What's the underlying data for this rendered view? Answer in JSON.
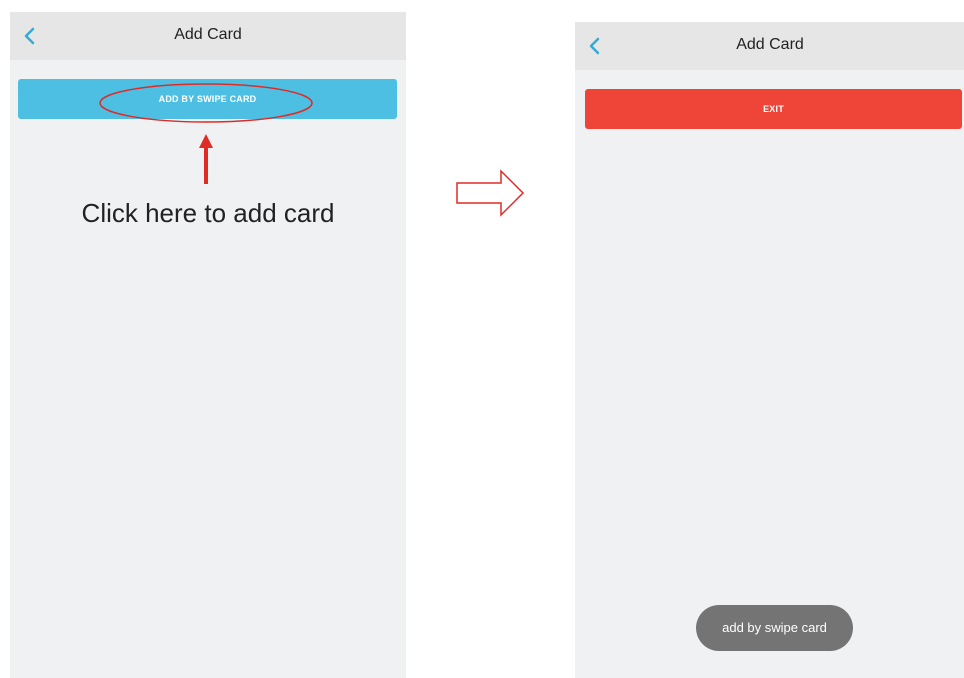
{
  "left_screen": {
    "header": {
      "back_icon": "chevron-left-icon",
      "title": "Add Card"
    },
    "swipe_button_label": "ADD BY SWIPE CARD",
    "annotation_text": "Click here to add card"
  },
  "right_screen": {
    "header": {
      "back_icon": "chevron-left-icon",
      "title": "Add Card"
    },
    "exit_button_label": "EXIT",
    "toast_text": "add by swipe card"
  },
  "colors": {
    "header_bg": "#e6e6e6",
    "screen_bg": "#f0f1f3",
    "back_icon": "#35a9d6",
    "swipe_button": "#4dbfe3",
    "exit_button": "#ee4538",
    "annotation": "#e02a26",
    "toast_bg": "#747474"
  }
}
